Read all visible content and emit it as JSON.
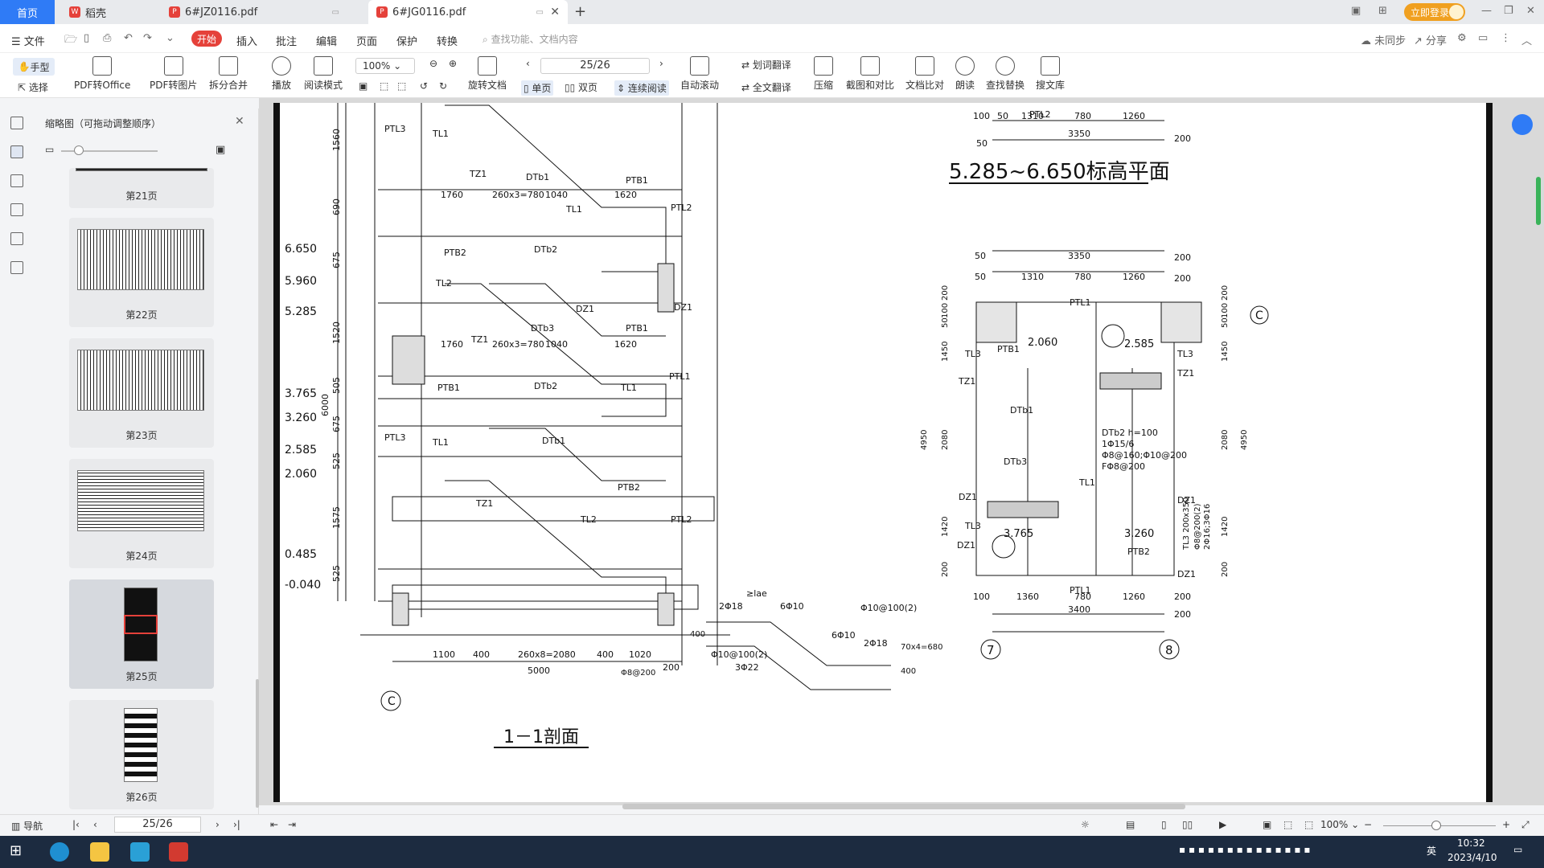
{
  "tabs": {
    "home": "首页",
    "tab1": "稻壳",
    "tab2": "6#JZ0116.pdf",
    "tab3": "6#JG0116.pdf",
    "login": "立即登录"
  },
  "menu": {
    "file": "文件",
    "start": "开始",
    "items": [
      "插入",
      "批注",
      "编辑",
      "页面",
      "保护",
      "转换"
    ],
    "search_placeholder": "查找功能、文档内容",
    "sync": "未同步",
    "share": "分享"
  },
  "toolbar": {
    "hand": "手型",
    "select": "选择",
    "pdf_to_office": "PDF转Office",
    "pdf_to_image": "PDF转图片",
    "split_merge": "拆分合并",
    "play": "播放",
    "read_mode": "阅读模式",
    "zoom": "100%",
    "page": "25/26",
    "rotate": "旋转文档",
    "single": "单页",
    "double": "双页",
    "continuous": "连续阅读",
    "auto_scroll": "自动滚动",
    "word_translate": "划词翻译",
    "full_translate": "全文翻译",
    "compress": "压缩",
    "screenshot_compare": "截图和对比",
    "doc_compare": "文档比对",
    "read_aloud": "朗读",
    "find_replace": "查找替换",
    "search_lib": "搜文库"
  },
  "thumbnails": {
    "title": "缩略图（可拖动调整顺序）",
    "pages": [
      "第21页",
      "第22页",
      "第23页",
      "第24页",
      "第25页",
      "第26页"
    ],
    "selected": "第25页"
  },
  "drawing": {
    "section_title": "1－1剖面",
    "plan_title": "5.285~6.650标高平面",
    "elevations": [
      "6.650",
      "5.960",
      "5.285",
      "3.765",
      "3.260",
      "2.585",
      "2.060",
      "0.485",
      "-0.040"
    ],
    "vertical_dims": [
      "1560",
      "690",
      "675",
      "1520",
      "505",
      "675",
      "525",
      "1575",
      "525",
      "6000"
    ],
    "labels_section": [
      "PTL3",
      "TL1",
      "TZ1",
      "DTb1",
      "PTB1",
      "1760",
      "260x3=780",
      "1040",
      "1620",
      "TL1",
      "PTL2",
      "PTB2",
      "DTb2",
      "TL2",
      "DZ1",
      "DTb3",
      "DZ1",
      "1760",
      "260x3=780",
      "1040",
      "1620",
      "PTB1",
      "TZ1",
      "DTb2",
      "TL1",
      "PTL1",
      "PTB1",
      "PTL3",
      "TL1",
      "DTb1",
      "TZ1",
      "PTB2",
      "TL2",
      "PTL2"
    ],
    "bottom_dims": [
      "1100",
      "400",
      "260x8=2080",
      "400",
      "1020",
      "200",
      "5000"
    ],
    "axis_c": "C",
    "plan_top_dims": [
      "100",
      "50",
      "1310",
      "780",
      "1260",
      "3350",
      "200",
      "50",
      "PTL2"
    ],
    "plan_dims_h": [
      "50",
      "3350",
      "200",
      "50",
      "1310",
      "780",
      "1260",
      "200"
    ],
    "plan_labels": [
      "PTL1",
      "PTB1",
      "2.060",
      "2.585",
      "TL3",
      "TZ1",
      "TZ1",
      "TL3",
      "DTb1",
      "DTb2 h=100",
      "1Φ15/6",
      "Φ8@160;Φ10@200",
      "FΦ8@200",
      "DTb3",
      "TL1",
      "DZ1",
      "DZ1",
      "TL3",
      "3.765",
      "3.260",
      "PTB2",
      "DZ1",
      "DZ1",
      "PTL1",
      "TL3 200x350",
      "Φ8@200(2)",
      "2Φ16;3Φ16"
    ],
    "plan_vdims_left": [
      "200",
      "100",
      "50",
      "1450",
      "2080",
      "1420",
      "200",
      "4950"
    ],
    "plan_vdims_right": [
      "200",
      "100",
      "50",
      "1450",
      "2080",
      "1420",
      "200",
      "4950"
    ],
    "plan_bottom_dims": [
      "100",
      "1360",
      "780",
      "1260",
      "200",
      "3400",
      "200"
    ],
    "axes": [
      "7",
      "8",
      "C"
    ],
    "detail_labels": [
      "≥lae",
      "2Φ18",
      "6Φ10",
      "Φ10@100(2)",
      "6Φ10",
      "2Φ18",
      "Φ10@100(2)",
      "3Φ22",
      "400",
      "400",
      "70x4=680",
      "Φ8@200"
    ]
  },
  "status": {
    "nav": "导航",
    "page": "25/26",
    "zoom": "100%"
  },
  "taskbar": {
    "time": "10:32",
    "date": "2023/4/10",
    "ime": "英"
  }
}
